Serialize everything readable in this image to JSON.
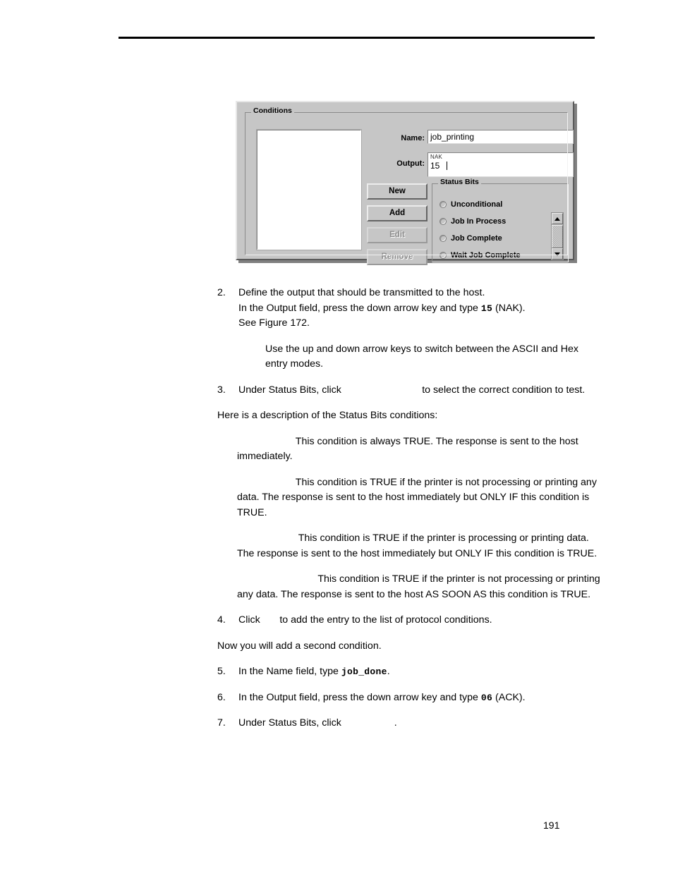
{
  "page": {
    "number": "191"
  },
  "figure": {
    "group_label": "Conditions",
    "fields": {
      "name_label": "Name:",
      "name_value": "job_printing",
      "output_label": "Output:",
      "output_ascii_hint": "NAK",
      "output_value": "15"
    },
    "buttons": [
      {
        "label": "New",
        "enabled": true
      },
      {
        "label": "Add",
        "enabled": true
      },
      {
        "label": "Edit",
        "enabled": false
      },
      {
        "label": "Remove",
        "enabled": false
      }
    ],
    "status_bits": {
      "group_label": "Status Bits",
      "options": [
        {
          "label": "Unconditional",
          "selected": false
        },
        {
          "label": "Job In Process",
          "selected": false
        },
        {
          "label": "Job Complete",
          "selected": false
        },
        {
          "label": "Wait Job Complete",
          "selected": false
        }
      ]
    },
    "list_box": {
      "items": []
    }
  },
  "body": {
    "step2": {
      "number": "2.",
      "line1": "Define the output that should be transmitted to the host.",
      "line2_a": "In the Output field, press the down arrow key and type ",
      "line2_mono": "15",
      "line2_b": " (NAK).",
      "line3": "See Figure 172."
    },
    "note": "Use the up and down arrow keys to switch between the ASCII and Hex entry modes.",
    "step3": {
      "number": "3.",
      "part_a": "Under Status Bits, click",
      "blank": "                             ",
      "part_b": "to select the correct condition to test."
    },
    "intro": "Here is a description of the Status Bits conditions:",
    "descriptions": [
      {
        "blank": "                     ",
        "text": "This condition is always TRUE. The response is sent to the host immediately."
      },
      {
        "blank": "                     ",
        "text": "This condition is TRUE if the printer is not processing or printing any data. The response is sent to the host immediately but ONLY IF this condition is TRUE."
      },
      {
        "blank": "                      ",
        "text": "This condition is TRUE if the printer is processing or printing data.  The response is sent to the host immediately but ONLY IF this condition is TRUE."
      },
      {
        "blank": "                             ",
        "text": "This condition is TRUE if the printer is not processing or printing any data. The response is sent to the host AS SOON AS this condition is TRUE."
      }
    ],
    "step4": {
      "number": "4.",
      "part_a": "Click",
      "blank": "       ",
      "part_b": "to add the entry to the list of protocol conditions."
    },
    "transition": "Now you will add a second condition.",
    "step5": {
      "number": "5.",
      "part_a": "In the Name field, type ",
      "mono": "job_done",
      "part_b": "."
    },
    "step6": {
      "number": "6.",
      "part_a": "In the Output field, press the down arrow key and type ",
      "mono": "06",
      "part_b": " (ACK)."
    },
    "step7": {
      "number": "7.",
      "part_a": "Under Status Bits, click",
      "blank": "                   ",
      "part_b": "."
    }
  }
}
